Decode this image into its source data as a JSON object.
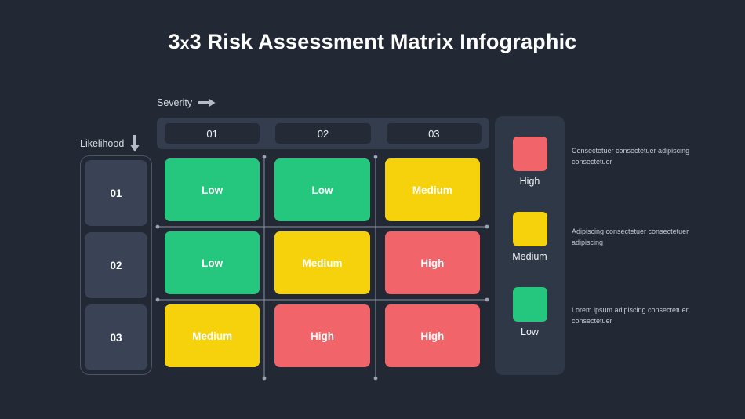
{
  "title": "3x3 Risk Assessment Matrix Infographic",
  "title_prefix": "3",
  "title_x": "x",
  "title_suffix": "3 Risk Assessment Matrix Infographic",
  "axes": {
    "severity_label": "Severity",
    "severity_arrow": "arrow-right-icon",
    "likelihood_label": "Likelihood",
    "likelihood_arrow": "arrow-down-icon"
  },
  "columns": [
    {
      "label": "01"
    },
    {
      "label": "02"
    },
    {
      "label": "03"
    }
  ],
  "rows": [
    {
      "label": "01"
    },
    {
      "label": "02"
    },
    {
      "label": "03"
    }
  ],
  "matrix": [
    [
      {
        "label": "Low",
        "level": "low",
        "color": "#25c77e"
      },
      {
        "label": "Low",
        "level": "low",
        "color": "#25c77e"
      },
      {
        "label": "Medium",
        "level": "medium",
        "color": "#f6d20d"
      }
    ],
    [
      {
        "label": "Low",
        "level": "low",
        "color": "#25c77e"
      },
      {
        "label": "Medium",
        "level": "medium",
        "color": "#f6d20d"
      },
      {
        "label": "High",
        "level": "high",
        "color": "#f0646a"
      }
    ],
    [
      {
        "label": "Medium",
        "level": "medium",
        "color": "#f6d20d"
      },
      {
        "label": "High",
        "level": "high",
        "color": "#f0646a"
      },
      {
        "label": "High",
        "level": "high",
        "color": "#f0646a"
      }
    ]
  ],
  "legend": [
    {
      "label": "High",
      "color": "#f0646a",
      "description": "Consectetuer consectetuer adipiscing consectetuer"
    },
    {
      "label": "Medium",
      "color": "#f6d20d",
      "description": "Adipiscing consectetuer consectetuer adipiscing"
    },
    {
      "label": "Low",
      "color": "#25c77e",
      "description": "Lorem ipsum adipiscing consectetuer consectetuer"
    }
  ],
  "colors": {
    "background": "#222834",
    "panel": "#2e3847",
    "header_bar": "#333d4d",
    "header_pill": "#242b37",
    "row_cell": "#394355",
    "gridline": "#8a93a3",
    "text_primary": "#ffffff",
    "text_muted": "#c4cad4"
  }
}
